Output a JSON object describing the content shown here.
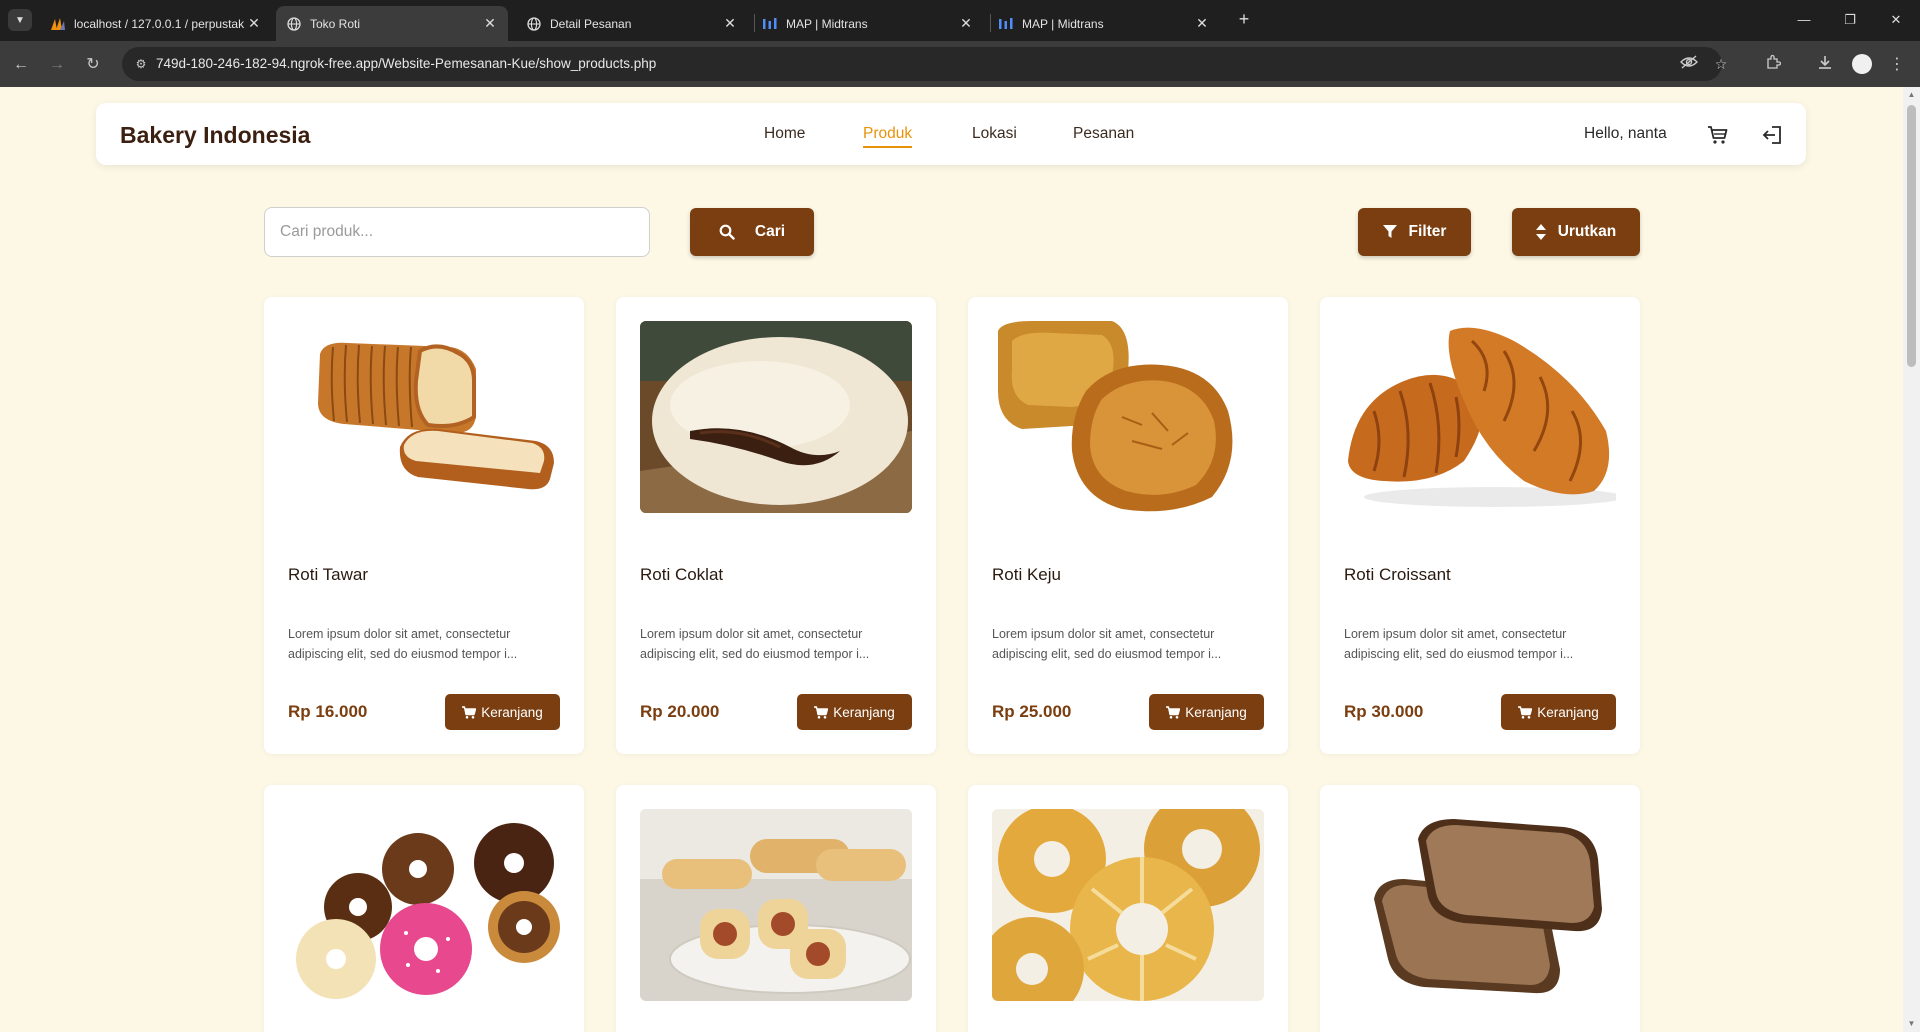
{
  "browser": {
    "tabs": [
      {
        "title": "localhost / 127.0.0.1 / perpustak",
        "favicon": "phpmyadmin-icon",
        "active": false
      },
      {
        "title": "Toko Roti",
        "favicon": "globe-icon",
        "active": true
      },
      {
        "title": "Detail Pesanan",
        "favicon": "globe-icon",
        "active": false
      },
      {
        "title": "MAP | Midtrans",
        "favicon": "midtrans-icon",
        "active": false
      },
      {
        "title": "MAP | Midtrans",
        "favicon": "midtrans-icon",
        "active": false
      }
    ],
    "url": "749d-180-246-182-94.ngrok-free.app/Website-Pemesanan-Kue/show_products.php"
  },
  "navbar": {
    "brand": "Bakery Indonesia",
    "links": [
      {
        "label": "Home",
        "active": false
      },
      {
        "label": "Produk",
        "active": true
      },
      {
        "label": "Lokasi",
        "active": false
      },
      {
        "label": "Pesanan",
        "active": false
      }
    ],
    "greeting": "Hello, nanta"
  },
  "search": {
    "placeholder": "Cari produk...",
    "button_label": "Cari"
  },
  "filter_label": "Filter",
  "sort_label": "Urutkan",
  "cart_button_label": "Keranjang",
  "colors": {
    "brand_brown": "#7a3e10",
    "active_link": "#e8920a",
    "page_bg": "#fdf8e6"
  },
  "products": [
    {
      "name": "Roti Tawar",
      "description": "Lorem ipsum dolor sit amet, consectetur adipiscing elit, sed do eiusmod tempor i...",
      "price": "Rp 16.000",
      "image": "sliced-bread-loaf"
    },
    {
      "name": "Roti Coklat",
      "description": "Lorem ipsum dolor sit amet, consectetur adipiscing elit, sed do eiusmod tempor i...",
      "price": "Rp 20.000",
      "image": "chocolate-bun"
    },
    {
      "name": "Roti Keju",
      "description": "Lorem ipsum dolor sit amet, consectetur adipiscing elit, sed do eiusmod tempor i...",
      "price": "Rp 25.000",
      "image": "cheese-bread"
    },
    {
      "name": "Roti Croissant",
      "description": "Lorem ipsum dolor sit amet, consectetur adipiscing elit, sed do eiusmod tempor i...",
      "price": "Rp 30.000",
      "image": "croissants"
    },
    {
      "image": "donuts"
    },
    {
      "image": "sausage-rolls"
    },
    {
      "image": "ring-bread"
    },
    {
      "image": "wheat-bread-slices"
    }
  ]
}
